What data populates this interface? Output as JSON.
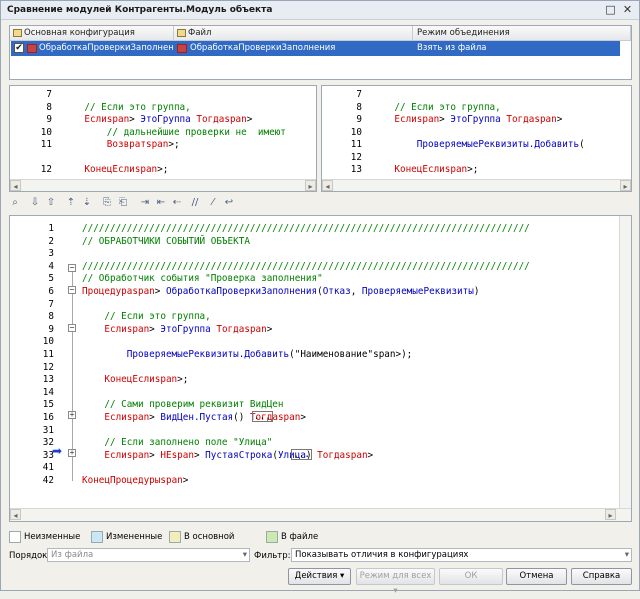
{
  "window": {
    "title": "Сравнение модулей Контрагенты.Модуль объекта",
    "minimize": "□",
    "close": "✕"
  },
  "grid": {
    "headers": [
      "Основная конфигурация",
      "Файл",
      "Режим объединения"
    ],
    "row": {
      "checked": "✔",
      "main": "ОбработкаПроверкиЗаполнения",
      "file": "ОбработкаПроверкиЗаполнения",
      "mode": "Взять из файла"
    }
  },
  "left_pane": {
    "lines": [
      {
        "n": "7",
        "t": ""
      },
      {
        "n": "8",
        "t": "    // Если это группа,"
      },
      {
        "n": "9",
        "t": "    Если ЭтоГруппа Тогда"
      },
      {
        "n": "10",
        "t": "        // дальнейшие проверки не  имеют"
      },
      {
        "n": "11",
        "t": "        Возврат;"
      },
      {
        "n": "",
        "t": ""
      },
      {
        "n": "12",
        "t": "    КонецЕсли;"
      }
    ]
  },
  "right_pane": {
    "lines": [
      {
        "n": "7",
        "t": ""
      },
      {
        "n": "8",
        "t": "    // Если это группа,"
      },
      {
        "n": "9",
        "t": "    Если ЭтоГруппа Тогда"
      },
      {
        "n": "10",
        "t": ""
      },
      {
        "n": "11",
        "t": "        ПроверяемыеРеквизиты.Добавить("
      },
      {
        "n": "12",
        "t": ""
      },
      {
        "n": "13",
        "t": "    КонецЕсли;"
      }
    ]
  },
  "toolbar_icons": [
    "find-icon",
    "arrow-down-icon",
    "arrow-up-icon",
    "prev-change-icon",
    "next-change-icon",
    "copy-icon",
    "paste-icon",
    "indent-icon",
    "unindent-icon",
    "shift-left-icon",
    "comment-icon",
    "uncomment-icon",
    "wrap-icon"
  ],
  "main_code": {
    "lines": [
      {
        "n": "1",
        "t": "////////////////////////////////////////////////////////////////////////////////"
      },
      {
        "n": "2",
        "t": "// ОБРАБОТЧИКИ СОБЫТИЙ ОБЪЕКТА"
      },
      {
        "n": "3",
        "t": ""
      },
      {
        "n": "4",
        "t": "////////////////////////////////////////////////////////////////////////////////"
      },
      {
        "n": "5",
        "t": "// Обработчик события \"Проверка заполнения\""
      },
      {
        "n": "6",
        "t": "Процедура ОбработкаПроверкиЗаполнения(Отказ, ПроверяемыеРеквизиты)"
      },
      {
        "n": "7",
        "t": ""
      },
      {
        "n": "8",
        "t": "    // Если это группа,"
      },
      {
        "n": "9",
        "t": "    Если ЭтоГруппа Тогда"
      },
      {
        "n": "10",
        "t": ""
      },
      {
        "n": "11",
        "t": "        ПроверяемыеРеквизиты.Добавить(\"Наименование\");"
      },
      {
        "n": "12",
        "t": ""
      },
      {
        "n": "13",
        "t": "    КонецЕсли;"
      },
      {
        "n": "14",
        "t": ""
      },
      {
        "n": "15",
        "t": "    // Сами проверим реквизит ВидЦен"
      },
      {
        "n": "16",
        "t": "    Если ВидЦен.Пустая() Тогда"
      },
      {
        "n": "31",
        "t": ""
      },
      {
        "n": "32",
        "t": "    // Если заполнено поле \"Улица\""
      },
      {
        "n": "33",
        "t": "    Если НЕ ПустаяСтрока(Улица) Тогда"
      },
      {
        "n": "41",
        "t": ""
      },
      {
        "n": "42",
        "t": "КонецПроцедуры"
      }
    ],
    "collapsed_marker": "..."
  },
  "legend": {
    "unchanged": "Неизменные",
    "changed": "Измененные",
    "in_main": "В основной",
    "in_file": "В файле",
    "colors": {
      "unchanged": "#ffffff",
      "changed": "#c9e7f5",
      "in_main": "#f1eebc",
      "in_file": "#cde8b1"
    }
  },
  "order": {
    "label": "Порядок:",
    "value": "Из файла"
  },
  "filter": {
    "label": "Фильтр:",
    "value": "Показывать отличия в конфигурациях"
  },
  "buttons": {
    "actions": "Действия",
    "mode_all": "Режим для всех",
    "ok": "ОК",
    "cancel": "Отмена",
    "help": "Справка"
  }
}
